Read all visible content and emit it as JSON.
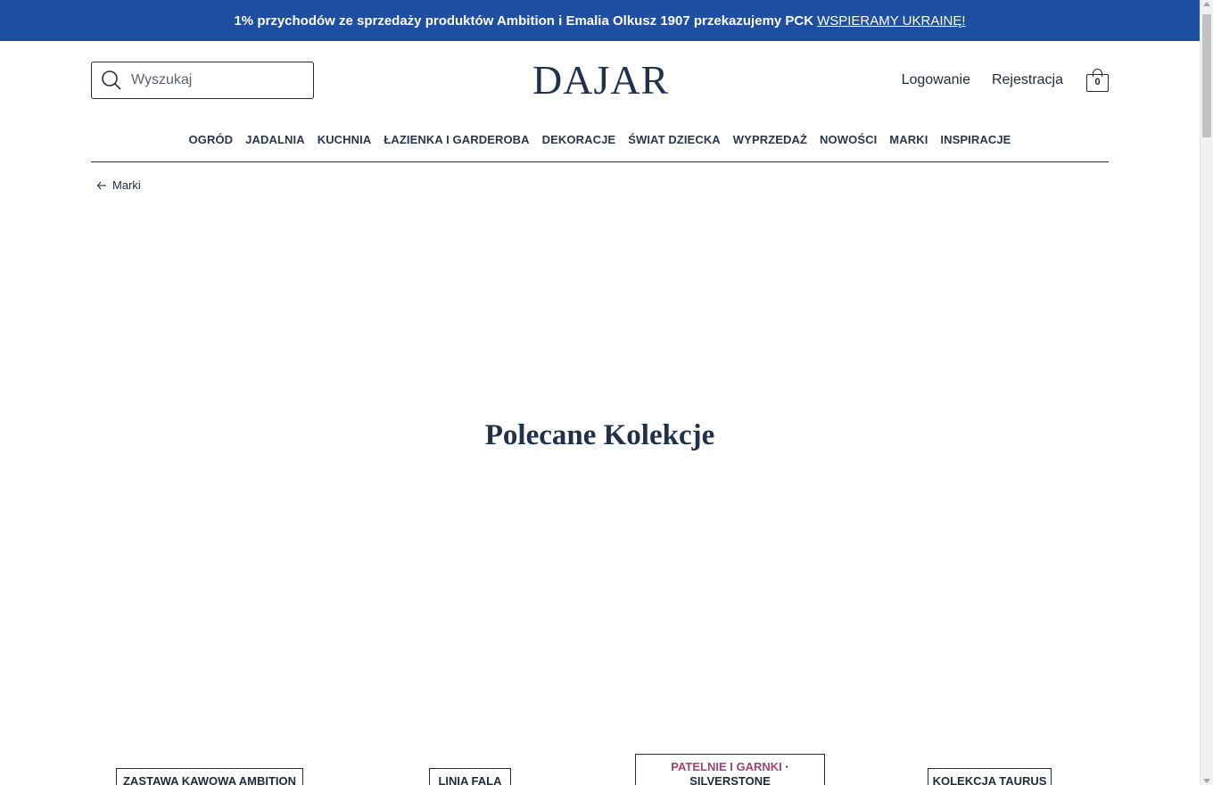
{
  "promo": {
    "text": "1% przychodów ze sprzedaży produktów Ambition i Emalia Olkusz 1907 przekazujemy PCK",
    "link": "WSPIERAMY UKRAINĘ!"
  },
  "search": {
    "placeholder": "Wyszukaj"
  },
  "logo": "DAJAR",
  "account": {
    "login": "Logowanie",
    "register": "Rejestracja",
    "cart_count": "0"
  },
  "nav": {
    "items": [
      {
        "label": "OGRÓD"
      },
      {
        "label": "JADALNIA"
      },
      {
        "label": "KUCHNIA"
      },
      {
        "label": "ŁAZIENKA I GARDEROBA"
      },
      {
        "label": "DEKORACJE"
      },
      {
        "label": "ŚWIAT DZIECKA"
      },
      {
        "label": "WYPRZEDAŻ"
      },
      {
        "label": "NOWOŚCI"
      },
      {
        "label": "MARKI"
      },
      {
        "label": "INSPIRACJE"
      }
    ]
  },
  "breadcrumb": {
    "back_label": "Marki"
  },
  "section": {
    "title": "Polecane Kolekcje"
  },
  "collections": [
    {
      "label": "ZASTAWA KAWOWA AMBITION"
    },
    {
      "label": "LINIA FALA"
    },
    {
      "category": "PATELNIE I GARNKI",
      "separator": "·",
      "label": "SILVERSTONE"
    },
    {
      "label": "KOLEKCJA TAURUS"
    }
  ],
  "colors": {
    "promo_bg": "#1e4fa0",
    "text": "#1f2a3a",
    "accent": "#a0446f"
  }
}
